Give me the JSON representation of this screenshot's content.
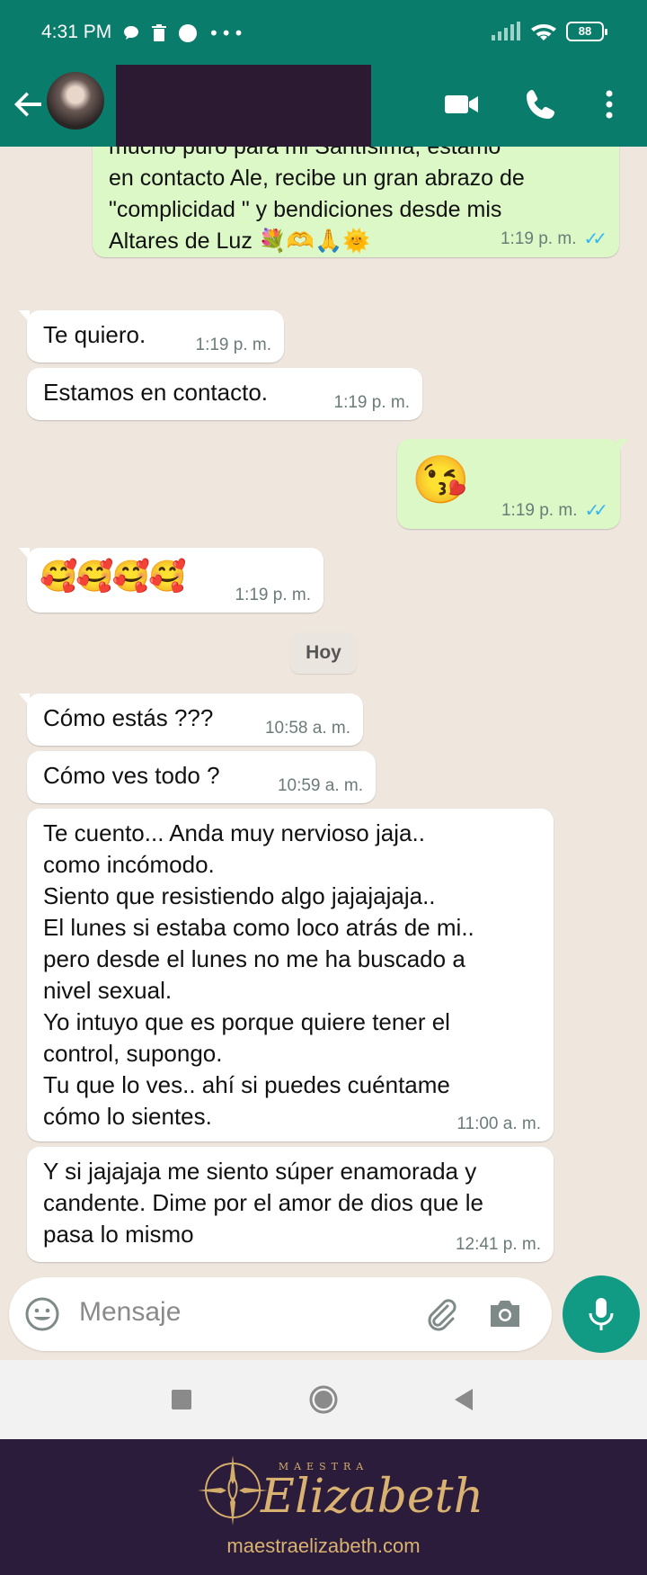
{
  "status_bar": {
    "time": "4:31 PM",
    "battery": "88"
  },
  "header": {
    "contact_name_redacted": true
  },
  "colors": {
    "header": "#0a7c6b",
    "outgoing_bubble": "#dcf8c6",
    "incoming_bubble": "#ffffff",
    "chat_background": "#efe7de",
    "read_ticks": "#34b7f1",
    "brand_background": "#2a1c3a",
    "brand_gold": "#d9b271"
  },
  "messages": [
    {
      "direction": "out",
      "text": "mucho puro para mi Santísima, estamo\nen contacto Ale, recibe un gran abrazo de\n\"complicidad \"  y bendiciones desde mis\nAltares de Luz 💐🫶🙏🌞",
      "time": "1:19 p. m.",
      "read": true
    },
    {
      "direction": "in",
      "text": "Te quiero.",
      "time": "1:19 p. m."
    },
    {
      "direction": "in",
      "text": "Estamos en contacto.",
      "time": "1:19 p. m."
    },
    {
      "direction": "out",
      "text": "😘",
      "time": "1:19 p. m.",
      "read": true
    },
    {
      "direction": "in",
      "text": "🥰🥰🥰🥰",
      "time": "1:19 p. m."
    },
    {
      "direction": "in",
      "text": "Cómo estás ???",
      "time": "10:58 a. m."
    },
    {
      "direction": "in",
      "text": "Cómo ves todo ?",
      "time": "10:59 a. m."
    },
    {
      "direction": "in",
      "text": "Te cuento... Anda muy nervioso jaja..\ncomo incómodo.\nSiento que resistiendo algo jajajajaja..\nEl lunes si estaba como loco atrás de mi..\npero desde el lunes no me ha buscado a\nnivel sexual.\nYo intuyo que es porque quiere tener el\ncontrol, supongo.\nTu que lo ves.. ahí si puedes cuéntame\ncómo lo sientes.",
      "time": "11:00 a. m."
    },
    {
      "direction": "in",
      "text": "Y si jajajaja me siento súper enamorada y\ncandente. Dime por el amor de dios que le\npasa lo mismo",
      "time": "12:41 p. m."
    }
  ],
  "day_divider": "Hoy",
  "composer": {
    "placeholder": "Mensaje"
  },
  "icons": [
    "back-arrow-icon",
    "video-call-icon",
    "phone-icon",
    "more-vert-icon",
    "emoji-icon",
    "attach-icon",
    "camera-icon",
    "mic-icon",
    "nav-recents-icon",
    "nav-home-icon",
    "nav-back-icon"
  ],
  "brand": {
    "tagline": "MAESTRA",
    "name": "Elizabeth",
    "url": "maestraelizabeth.com"
  }
}
